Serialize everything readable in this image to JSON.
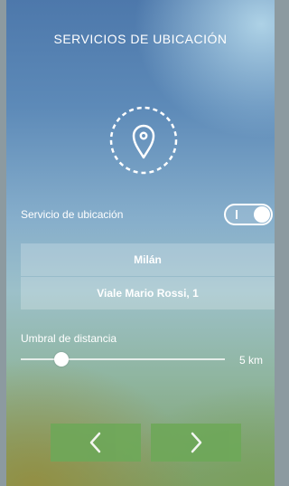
{
  "header": {
    "title": "SERVICIOS DE UBICACIÓN"
  },
  "icons": {
    "location": "location-pin-icon",
    "back": "chevron-left-icon",
    "forward": "chevron-right-icon"
  },
  "location_service": {
    "label": "Servicio de ubicación",
    "enabled": true,
    "on_mark": "I"
  },
  "address": {
    "city": "Milán",
    "street": "Viale Mario Rossi, 1"
  },
  "distance": {
    "label": "Umbral de distancia",
    "value_text": "5 km",
    "slider_fraction": 0.2
  },
  "colors": {
    "accent_green": "#6ea859",
    "text": "#ffffff"
  }
}
